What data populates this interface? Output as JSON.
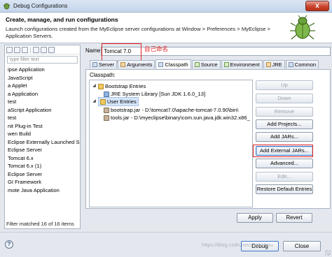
{
  "window": {
    "title": "Debug Configurations",
    "close_glyph": "x"
  },
  "header": {
    "title": "Create, manage, and run configurations",
    "description": "Launch configurations created from the MyEclipse server configurations at Window > Preferences > MyEclipse > Application Servers."
  },
  "left": {
    "filter_placeholder": "type filter text",
    "items": [
      "ipse Application",
      "JavaScript",
      "a Applet",
      "a Application",
      "test",
      "aScript Application",
      "test",
      "nit Plug-in Test",
      "wen Build",
      "Eclipse Externally Launched S",
      "Eclipse Server",
      "Tomcat  6.x",
      "Tomcat  6.x (1)",
      "Eclipse Server",
      "GI Framework",
      "mote Java Application"
    ],
    "status": "Filter matched 16 of 16 items"
  },
  "config": {
    "name_label": "Name:",
    "name_value": "Tomcat  7.0",
    "annotation": "自己命名"
  },
  "tabs": [
    {
      "label": "Server",
      "icon": "server-icon"
    },
    {
      "label": "Arguments",
      "icon": "arguments-icon"
    },
    {
      "label": "Classpath",
      "icon": "classpath-icon"
    },
    {
      "label": "Source",
      "icon": "source-icon"
    },
    {
      "label": "Environment",
      "icon": "environment-icon"
    },
    {
      "label": "JRE",
      "icon": "jre-icon"
    },
    {
      "label": "Common",
      "icon": "common-icon"
    }
  ],
  "classpath": {
    "label": "Classpath:",
    "bootstrap": "Bootstrap Entries",
    "jre_lib": "JRE System Library [Sun JDK 1.6.0_13]",
    "user_entries": "User Entries",
    "bootstrap_jar": "bootstrap.jar - D:\\tomcat7.0\\apache-tomcat-7.0.90\\bin\\",
    "tools_jar": "tools.jar - D:\\myeclipse\\binary\\com.sun.java.jdk.win32.x86_"
  },
  "buttons": {
    "up": "Up",
    "down": "Down",
    "remove": "Remove",
    "add_projects": "Add Projects...",
    "add_jars": "Add JARs...",
    "add_external_jars": "Add External JARs...",
    "advanced": "Advanced...",
    "edit": "Edit...",
    "restore": "Restore Default Entries",
    "apply": "Apply",
    "revert": "Revert",
    "debug": "Debug",
    "close": "Close",
    "help": "?"
  },
  "watermark": "https://blog.csdn.net/zhouzhou",
  "colors": {
    "annotation": "#e02020",
    "accent": "#3d79c9"
  }
}
